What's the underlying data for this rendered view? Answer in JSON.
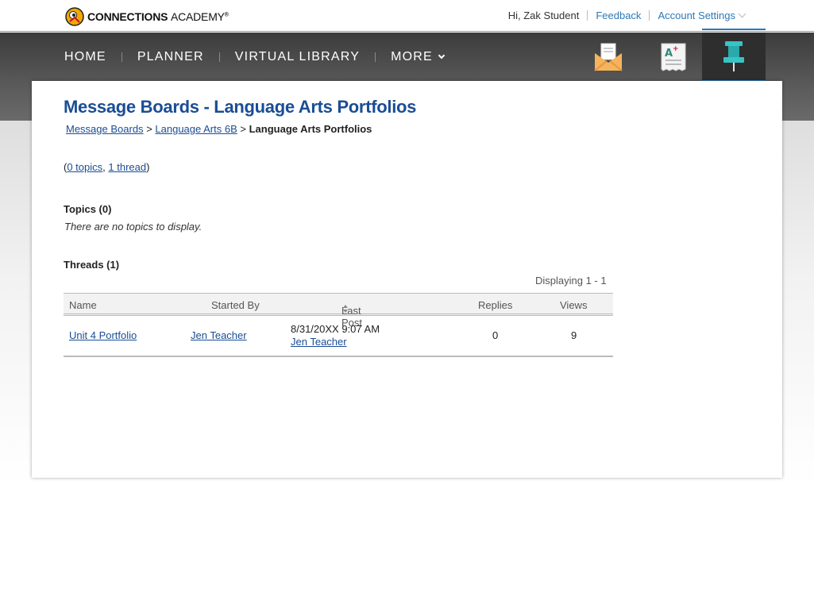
{
  "brand": {
    "name_bold": "CONNECTIONS",
    "name_light": "ACADEMY",
    "mark": "®"
  },
  "header": {
    "greeting": "Hi, Zak Student",
    "feedback": "Feedback",
    "account_settings": "Account Settings"
  },
  "nav": {
    "items": [
      "HOME",
      "PLANNER",
      "VIRTUAL LIBRARY",
      "MORE"
    ],
    "icons": [
      "mail-envelope-icon",
      "graded-paper-icon",
      "pushpin-icon"
    ],
    "active_icon": "pushpin-icon"
  },
  "page": {
    "title": "Message Boards - Language Arts Portfolios",
    "breadcrumb": [
      {
        "label": "Message Boards",
        "link": true
      },
      {
        "label": "Language Arts 6B",
        "link": true
      },
      {
        "label": "Language Arts Portfolios",
        "link": false
      }
    ],
    "breadcrumb_sep": ">",
    "counts": {
      "open": "(",
      "topics": "0 topics",
      "comma": ",",
      "threads": "1 thread",
      "close": ")"
    },
    "topics_heading": "Topics (0)",
    "no_topics": "There are no topics to display.",
    "threads_heading": "Threads (1)",
    "displaying": "Displaying 1 - 1"
  },
  "threads_table": {
    "columns": [
      "Name",
      "Started By",
      "Last Post",
      "Replies",
      "Views"
    ],
    "rows": [
      {
        "name": "Unit 4 Portfolio",
        "started_by": "Jen Teacher",
        "last_post_date": "8/31/20XX 9:07 AM",
        "last_post_by": "Jen Teacher",
        "replies": "0",
        "views": "9"
      }
    ]
  },
  "colors": {
    "accent": "#2c79b7",
    "title": "#1a4d94",
    "nav_bg": "#4a4a4a"
  }
}
